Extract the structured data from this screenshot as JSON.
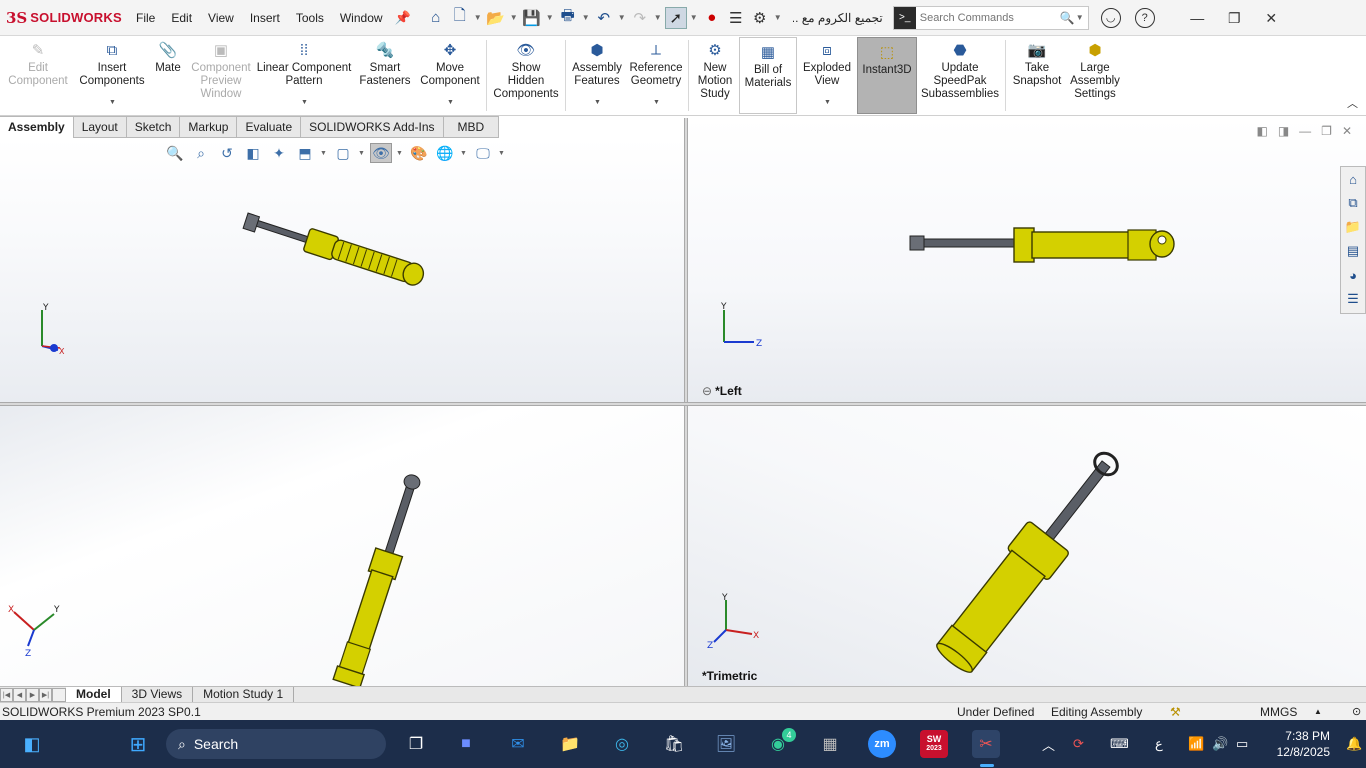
{
  "app": {
    "brand_ds": "3S",
    "brand_name": "SOLIDWORKS",
    "doc_title": "تجميع الكروم مع ..."
  },
  "menu": [
    "File",
    "Edit",
    "View",
    "Insert",
    "Tools",
    "Window"
  ],
  "search": {
    "placeholder": "Search Commands"
  },
  "ribbon": {
    "edit_component": "Edit\nComponent",
    "insert_components": "Insert\nComponents",
    "mate": "Mate",
    "component_preview": "Component\nPreview\nWindow",
    "linear_pattern": "Linear Component\nPattern",
    "smart_fasteners": "Smart\nFasteners",
    "move_component": "Move\nComponent",
    "show_hidden": "Show\nHidden\nComponents",
    "assembly_features": "Assembly\nFeatures",
    "reference_geometry": "Reference\nGeometry",
    "new_motion_study": "New\nMotion\nStudy",
    "bill_of_materials": "Bill of\nMaterials",
    "exploded_view": "Exploded\nView",
    "instant3d": "Instant3D",
    "update_speedpak": "Update\nSpeedPak\nSubassemblies",
    "take_snapshot": "Take\nSnapshot",
    "large_assembly": "Large\nAssembly\nSettings"
  },
  "tabs": [
    "Assembly",
    "Layout",
    "Sketch",
    "Markup",
    "Evaluate",
    "SOLIDWORKS Add-Ins",
    "MBD"
  ],
  "viewports": {
    "top_right_label": "*Left",
    "bottom_right_label": "*Trimetric",
    "axis_x": "X",
    "axis_y": "Y",
    "axis_z": "Z"
  },
  "model_tabs": [
    "Model",
    "3D Views",
    "Motion Study 1"
  ],
  "status": {
    "product": "SOLIDWORKS Premium 2023 SP0.1",
    "definition": "Under Defined",
    "mode": "Editing Assembly",
    "units": "MMGS"
  },
  "taskbar": {
    "search_label": "Search",
    "whatsapp_badge": "4",
    "zoom_label": "zm",
    "sw_label": "SW",
    "sw_year": "2023",
    "lang": "ع",
    "time": "7:38 PM",
    "date": "12/8/2025"
  },
  "colors": {
    "brand": "#c8102e",
    "part_yellow": "#d4d000",
    "part_outline": "#3a3a00",
    "rod_gray": "#5a5e66",
    "taskbar": "#1c2d4a"
  }
}
